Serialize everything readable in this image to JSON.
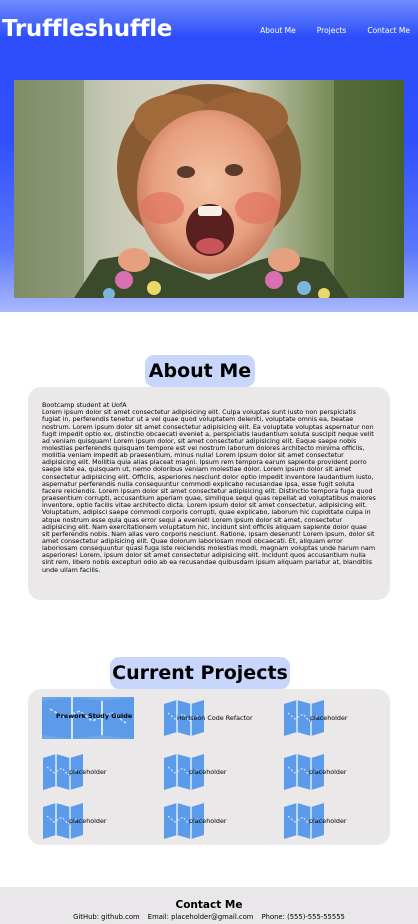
{
  "header": {
    "title": "Truffleshuffle",
    "nav": [
      {
        "label": "About Me"
      },
      {
        "label": "Projects"
      },
      {
        "label": "Contact Me"
      }
    ]
  },
  "about": {
    "heading": "About Me",
    "intro": "Bootcamp student at UofA",
    "body": "Lorem ipsum dolor sit amet consectetur adipisicing elit. Culpa voluptas sunt iusto non perspiciatis fugiat in, perferendis tenetur ut a vel quae quod voluptatem deleniti, voluptate omnis ea, beatae nostrum. Lorem ipsum dolor sit amet consectetur adipisicing elit. Ea voluptate voluptas aspernatur non fugit impedit optio ex, distinctio obcaecati eveniet a, perspiciatis laudantium soluta suscipit neque velit ad veniam quisquam! Lorem ipsum dolor, sit amet consectetur adipisicing elit. Eaque saepe nobis molestias perferendis quisquam tempore est vel nostrum laborum dolores architecto minima officiis, mollitia veniam impedit ab praesentium, minus nulla! Lorem ipsum dolor sit amet consectetur adipisicing elit. Mollitia quia alias placeat magni. Ipsum rem tempora earum sapiente provident porro saepe iste ea, quisquam ut, nemo doloribus veniam molestiae dolor. Lorem ipsum dolor sit amet consectetur adipisicing elit. Officiis, asperiores nesciunt dolor optio impedit inventore laudantium iusto, aspernatur perferendis nulla consequuntur commodi explicabo recusandae ipsa, esse fugit soluta facere reiciendis. Lorem ipsum dolor sit amet consectetur adipisicing elit. Distinctio tempora fuga quod praesentium corrupti, accusantium aperiam quae, similique sequi quas repellat ad voluptatibus maiores inventore, optio facilis vitae architecto dicta. Lorem ipsum dolor sit amet consectetur, adipisicing elit. Voluptatum, adipisci saepe commodi corporis corrupti, quae explicabo, laborum hic cupiditate culpa in atque nostrum esse quia quas error sequi a eveniet! Lorem ipsum dolor sit amet, consectetur adipisicing elit. Nam exercitationem voluptatum hic, incidunt sint officiis aliquam sapiente dolor quae sit perferendis nobis. Nam alias vero corporis nesciunt. Ratione, ipsam deserunt! Lorem ipsum, dolor sit amet consectetur adipisicing elit. Quae dolorum laboriosam modi obcaecati. Et, aliquam error laboriosam consequuntur quasi fuga iste reiciendis molestias modi, magnam voluptas unde harum nam asperiores! Lorem, ipsum dolor sit amet consectetur adipisicing elit. Incidunt quos accusantium nulla sint rem, libero nobis excepturi odio ab ea recusandae quibusdam ipsum aliquam pariatur at, blanditiis unde ullam facilis."
  },
  "projects": {
    "heading": "Current Projects",
    "items": [
      {
        "label": "Prework Study Guide"
      },
      {
        "label": "Horiseon Code Refactor"
      },
      {
        "label": "placeholder"
      },
      {
        "label": "placeholder"
      },
      {
        "label": "placeholder"
      },
      {
        "label": "placeholder"
      },
      {
        "label": "placeholder"
      },
      {
        "label": "placeholder"
      },
      {
        "label": "placeholder"
      }
    ]
  },
  "footer": {
    "title": "Contact Me",
    "github": "GitHub: github.com",
    "email": "Email: placeholder@gmail.com",
    "phone": "Phone: (555)-555-55555"
  },
  "colors": {
    "header_blue": "#3150fb",
    "pill_bg": "#c9d6fc",
    "card_bg": "#ebe8ea",
    "map_icon": "#5b9bea"
  }
}
